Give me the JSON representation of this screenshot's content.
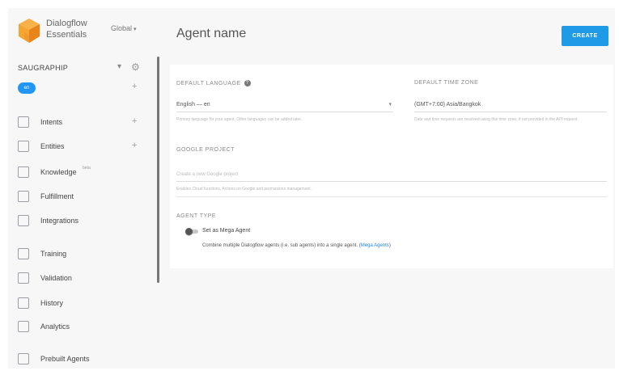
{
  "brand": {
    "name_line1": "Dialogflow",
    "name_line2": "Essentials",
    "region": "Global"
  },
  "agent": {
    "name": "SAUGRAPHIP"
  },
  "language_badge": "en",
  "nav": [
    {
      "label": "Intents",
      "icon": "chat-bubble-icon",
      "has_add": true
    },
    {
      "label": "Entities",
      "icon": "hierarchy-icon",
      "has_add": true
    },
    {
      "label": "Knowledge",
      "icon": "book-icon",
      "badge": "beta",
      "has_add": false
    },
    {
      "label": "Fulfillment",
      "icon": "bolt-icon",
      "has_add": false
    },
    {
      "label": "Integrations",
      "icon": "integrations-icon",
      "has_add": false
    },
    {
      "label": "Training",
      "icon": "graduation-cap-icon",
      "has_add": false
    },
    {
      "label": "Validation",
      "icon": "checklist-icon",
      "has_add": false
    },
    {
      "label": "History",
      "icon": "clock-icon",
      "has_add": false
    },
    {
      "label": "Analytics",
      "icon": "chart-icon",
      "has_add": false
    },
    {
      "label": "Prebuilt Agents",
      "icon": "prebuilt-icon",
      "has_add": false
    }
  ],
  "header": {
    "title": "Agent name",
    "create_label": "CREATE"
  },
  "form": {
    "default_language": {
      "label": "DEFAULT LANGUAGE",
      "value": "English — en",
      "hint": "Primary language for your agent. Other languages can be added later."
    },
    "default_timezone": {
      "label": "DEFAULT TIME ZONE",
      "value": "(GMT+7:00) Asia/Bangkok",
      "hint": "Date and time requests are resolved using this time zone, if not provided in the API request."
    },
    "google_project": {
      "label": "GOOGLE PROJECT",
      "placeholder": "Create a new Google project",
      "hint": "Enables Cloud functions, Actions on Google and permissions management."
    },
    "agent_type": {
      "label": "AGENT TYPE",
      "toggle_label": "Set as Mega Agent",
      "description": "Combine multiple Dialogflow agents (i.e. sub agents) into a single agent.",
      "link": "Mega Agents"
    }
  },
  "colors": {
    "accent": "#1e9ae6",
    "badge": "#2196f3",
    "logo_orange": "#f59a23"
  }
}
